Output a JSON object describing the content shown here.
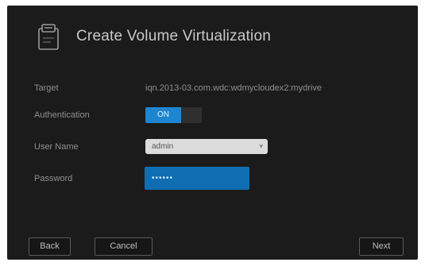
{
  "dialog": {
    "title": "Create Volume Virtualization",
    "title_icon": "volume-virtualization-icon"
  },
  "form": {
    "target": {
      "label": "Target",
      "value": "iqn.2013-03.com.wdc:wdmycloudex2:mydrive"
    },
    "authentication": {
      "label": "Authentication",
      "on_label": "ON",
      "off_label": "",
      "state": "on"
    },
    "user_name": {
      "label": "User Name",
      "selected": "admin"
    },
    "password": {
      "label": "Password",
      "value": "••••••"
    }
  },
  "footer": {
    "back_label": "Back",
    "cancel_label": "Cancel",
    "next_label": "Next"
  },
  "colors": {
    "dialog_bg": "#1b1b1b",
    "accent": "#1e86d0",
    "password_bg": "#0f6eb2",
    "text_muted": "#8f8f8f"
  }
}
